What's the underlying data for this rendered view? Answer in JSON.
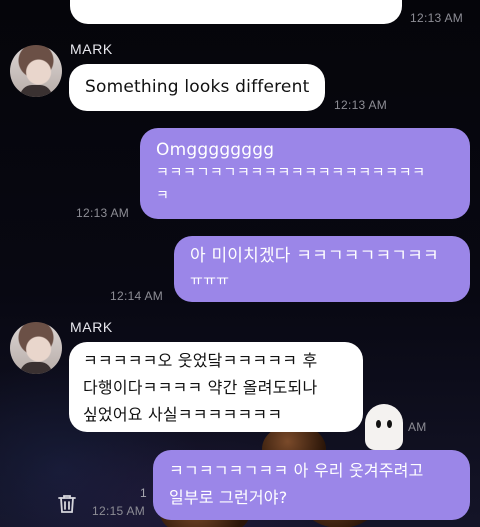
{
  "messages": [
    {
      "id": "m0",
      "from": "self_prev",
      "time": "12:13 AM"
    },
    {
      "id": "m1",
      "from": "MARK",
      "direction": "incoming",
      "lines": [
        "Something looks different"
      ],
      "time": "12:13 AM"
    },
    {
      "id": "m2",
      "from": "me",
      "direction": "outgoing",
      "lines": [
        "Omgggggggg",
        "ㅋㅋㅋㄱㅋㄱㅋㅋㅋㅋㅋㅋㅋㅋㅋㅋㅋㅋㅋㅋ",
        "ㅋ"
      ],
      "time": "12:13 AM"
    },
    {
      "id": "m3",
      "from": "me",
      "direction": "outgoing",
      "lines": [
        "아 미이치겠다 ㅋㅋㄱㅋㄱㅋㄱㅋㅋ",
        "ㅠㅠㅠ"
      ],
      "time": "12:14 AM"
    },
    {
      "id": "m4",
      "from": "MARK",
      "direction": "incoming",
      "lines": [
        "ㅋㅋㅋㅋㅋ오 웃었닼ㅋㅋㅋㅋㅋ 후",
        "다행이다ㅋㅋㅋㅋ 약간 올려도되나",
        "싶었어요 사실ㅋㅋㅋㅋㅋㅋㅋ"
      ],
      "time_partial": "AM"
    },
    {
      "id": "m5",
      "from": "me",
      "direction": "outgoing",
      "lines": [
        "ㅋㄱㅋㄱㅋㄱㅋㅋ 아 우리 웃겨주려고",
        "일부로 그런거야?"
      ],
      "time": "12:15 AM",
      "time_fragment": "1"
    }
  ],
  "sender_name": "MARK",
  "icons": {
    "delete": "trash-icon",
    "avatar": "profile-photo"
  },
  "colors": {
    "outgoing_bubble": "#9b86e8",
    "incoming_bubble": "#ffffff",
    "timestamp": "#8d8d95",
    "background": "#07070c"
  }
}
